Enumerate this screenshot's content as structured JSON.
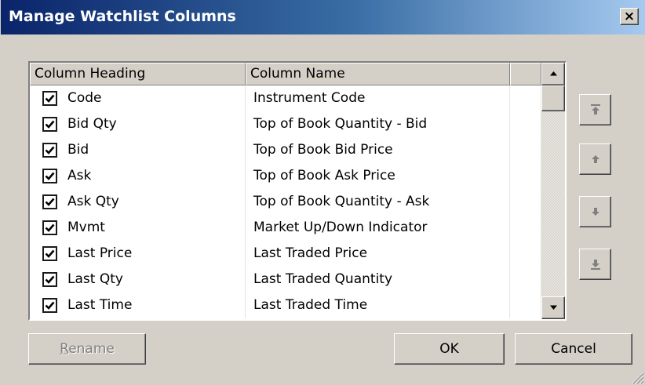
{
  "dialog": {
    "title": "Manage Watchlist Columns",
    "close_glyph": "×"
  },
  "table": {
    "headers": [
      "Column Heading",
      "Column Name",
      ""
    ],
    "rows": [
      {
        "checked": true,
        "heading": "Code",
        "name": "Instrument Code"
      },
      {
        "checked": true,
        "heading": "Bid Qty",
        "name": "Top of Book Quantity - Bid"
      },
      {
        "checked": true,
        "heading": "Bid",
        "name": "Top of Book Bid Price"
      },
      {
        "checked": true,
        "heading": "Ask",
        "name": "Top of Book Ask Price"
      },
      {
        "checked": true,
        "heading": "Ask Qty",
        "name": "Top of Book Quantity - Ask"
      },
      {
        "checked": true,
        "heading": "Mvmt",
        "name": "Market Up/Down Indicator"
      },
      {
        "checked": true,
        "heading": "Last Price",
        "name": "Last Traded Price"
      },
      {
        "checked": true,
        "heading": "Last Qty",
        "name": "Last Traded Quantity"
      },
      {
        "checked": true,
        "heading": "Last Time",
        "name": "Last Traded Time"
      }
    ]
  },
  "side_buttons": [
    {
      "icon": "move-to-top-icon"
    },
    {
      "icon": "move-up-icon"
    },
    {
      "icon": "move-down-icon"
    },
    {
      "icon": "move-to-bottom-icon"
    }
  ],
  "buttons": {
    "rename_mnemonic": "R",
    "rename_rest": "ename",
    "ok": "OK",
    "cancel": "Cancel"
  },
  "colors": {
    "title_start": "#0a246a",
    "title_end": "#a6caf0",
    "face": "#d4d0c8"
  }
}
